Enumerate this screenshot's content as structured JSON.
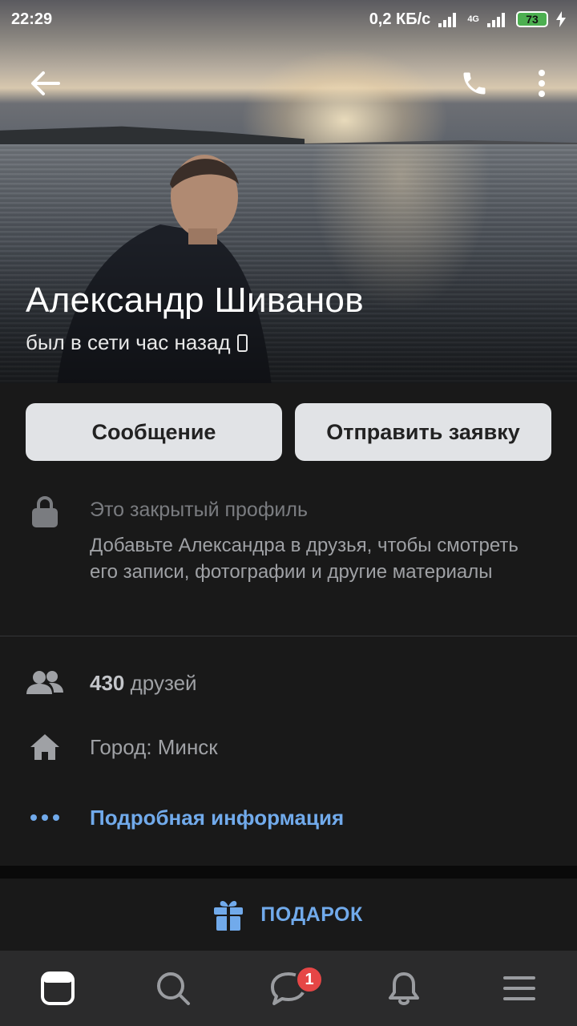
{
  "status_bar": {
    "time": "22:29",
    "network_speed": "0,2 КБ/с",
    "network_type": "4G",
    "battery": "73"
  },
  "header": {
    "back_icon": "arrow-left-icon",
    "call_icon": "phone-icon",
    "more_icon": "more-vertical-icon"
  },
  "profile": {
    "name": "Александр Шиванов",
    "status": "был в сети час назад",
    "status_device_icon": "mobile-phone-icon"
  },
  "actions": {
    "message_label": "Сообщение",
    "friend_request_label": "Отправить заявку"
  },
  "closed_profile": {
    "icon": "lock-icon",
    "title": "Это закрытый профиль",
    "description": "Добавьте Александра в друзья, чтобы смотреть его записи, фотографии и другие материалы"
  },
  "info": {
    "friends_count": "430",
    "friends_label": "друзей",
    "city": "Город: Минск",
    "more_info": "Подробная информация"
  },
  "gift": {
    "label": "ПОДАРОК",
    "icon": "gift-icon"
  },
  "tabbar": {
    "items": [
      "news-icon",
      "search-icon",
      "messages-icon",
      "notifications-icon",
      "menu-icon"
    ],
    "messages_badge": "1"
  },
  "colors": {
    "background": "#191919",
    "accent": "#71aaeb",
    "button_bg": "#e1e3e6",
    "badge": "#e64646",
    "tabbar": "#2b2b2c"
  }
}
